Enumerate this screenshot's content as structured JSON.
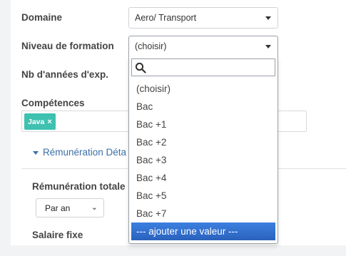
{
  "form": {
    "domaine_label": "Domaine",
    "domaine_value": "Aero/ Transport",
    "niveau_label": "Niveau de formation",
    "niveau_value": "(choisir)",
    "annees_label": "Nb d'années d'exp.",
    "competences_label": "Compétences",
    "competences_tags": [
      {
        "label": "Java",
        "remove": "×"
      }
    ]
  },
  "remuneration": {
    "section_label": "Rémunération Déta",
    "total_label": "Rémunération totale",
    "period_value": "Par an",
    "fixe_label": "Salaire fixe"
  },
  "dropdown": {
    "search_placeholder": "",
    "options": [
      "(choisir)",
      "Bac",
      "Bac +1",
      "Bac +2",
      "Bac +3",
      "Bac +4",
      "Bac +5",
      "Bac +7",
      "--- ajouter une valeur ---"
    ],
    "highlighted_index": 8
  },
  "colors": {
    "tag": "#3fc1b0",
    "highlight": "#3875d7",
    "link": "#3a6fa6"
  }
}
